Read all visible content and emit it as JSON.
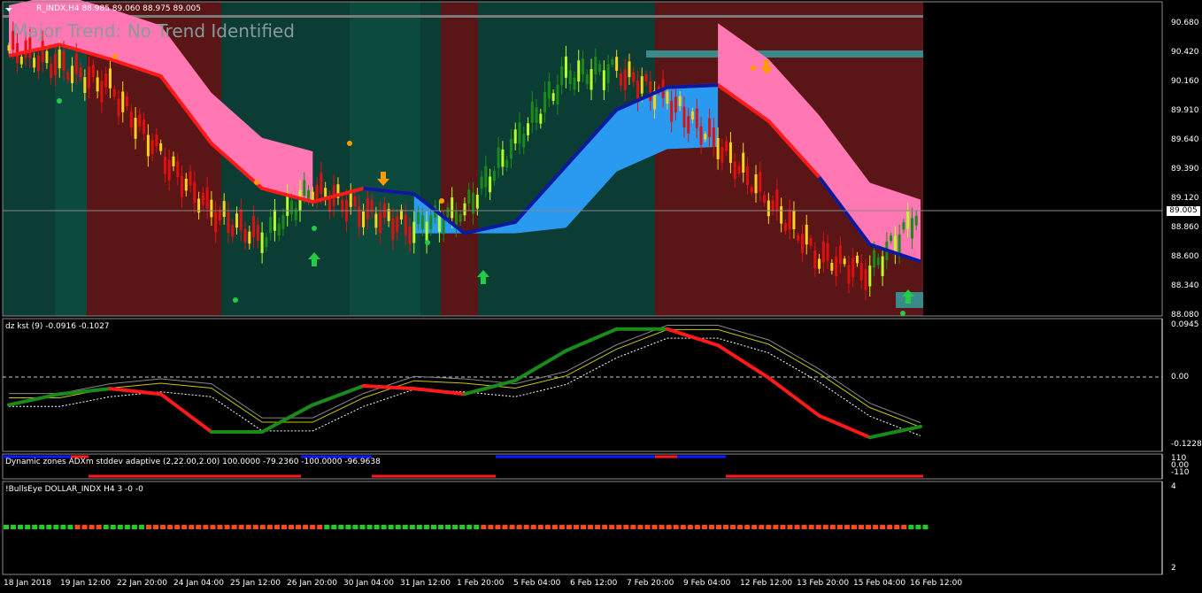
{
  "main": {
    "symbol_header": "R_INDX,H4  88.985 89.060 88.975 89.005",
    "trend_text": "Major Trend: No Trend Identified",
    "current_price": "89.005",
    "y_ticks": [
      "90.680",
      "90.420",
      "90.160",
      "89.910",
      "89.640",
      "89.390",
      "89.120",
      "88.860",
      "88.600",
      "88.340",
      "88.080"
    ]
  },
  "kst": {
    "label": "dz kst (9) -0.0916 -0.1027",
    "y_ticks": [
      "0.0945",
      "0.00",
      "-0.1228"
    ]
  },
  "adx": {
    "label": "Dynamic zones ADXm stddev adaptive (2,22.00,2.00) 100.0000 -79.2360 -100.0000 -96.9638",
    "y_ticks": [
      "110",
      "0.00",
      "-110"
    ]
  },
  "bulls": {
    "label": "!BullsEye DOLLAR_INDX H4 3 -0 -0",
    "y_ticks": [
      "4",
      "2"
    ]
  },
  "time_axis": [
    "18 Jan 2018",
    "19 Jan 12:00",
    "22 Jan 20:00",
    "24 Jan 04:00",
    "25 Jan 12:00",
    "26 Jan 20:00",
    "30 Jan 04:00",
    "31 Jan 12:00",
    "1 Feb 20:00",
    "5 Feb 04:00",
    "6 Feb 12:00",
    "7 Feb 20:00",
    "9 Feb 04:00",
    "12 Feb 12:00",
    "13 Feb 20:00",
    "15 Feb 04:00",
    "16 Feb 12:00"
  ],
  "chart_data": [
    {
      "type": "line",
      "title": "R_INDX,H4",
      "ylim": [
        88.08,
        90.68
      ],
      "series": [
        {
          "name": "trend",
          "values": [
            90.38,
            90.48,
            90.35,
            90.2,
            89.6,
            89.2,
            89.08,
            89.2,
            89.15,
            88.8,
            88.9,
            89.4,
            89.9,
            90.1,
            90.12,
            89.8,
            89.3,
            88.7,
            88.55
          ]
        },
        {
          "name": "price",
          "values": [
            90.45,
            90.3,
            90.1,
            89.5,
            89.0,
            88.75,
            89.2,
            89.0,
            88.85,
            89.0,
            89.6,
            90.2,
            90.25,
            90.0,
            89.6,
            89.1,
            88.6,
            88.45,
            89.0
          ]
        }
      ]
    },
    {
      "type": "line",
      "title": "dz kst (9)",
      "ylim": [
        -0.1228,
        0.0945
      ],
      "series": [
        {
          "name": "kst",
          "values": [
            -0.05,
            -0.03,
            -0.02,
            -0.03,
            -0.1,
            -0.1,
            -0.05,
            -0.015,
            -0.02,
            -0.03,
            -0.005,
            0.05,
            0.09,
            0.09,
            0.06,
            0.0,
            -0.07,
            -0.11,
            -0.09
          ]
        }
      ]
    }
  ]
}
